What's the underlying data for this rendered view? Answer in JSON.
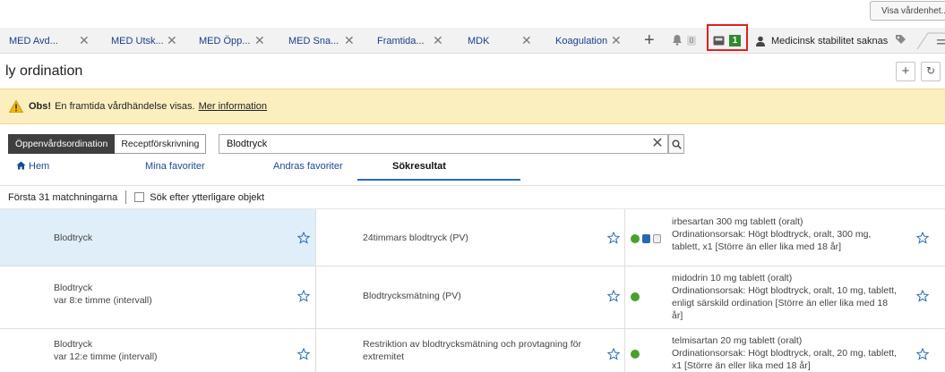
{
  "top_corner_label": "Visa vårdenhet...",
  "tabs": [
    {
      "label": "MED Avd..."
    },
    {
      "label": "MED Utsk..."
    },
    {
      "label": "MED Öpp..."
    },
    {
      "label": "MED Sna..."
    },
    {
      "label": "Framtida..."
    },
    {
      "label": "MDK"
    },
    {
      "label": "Koagulation"
    }
  ],
  "toolbar": {
    "notification_count": "0",
    "inbox_count": "1",
    "patient_status": "Medicinsk stabilitet saknas"
  },
  "page": {
    "title": "ly ordination",
    "add_label": "+",
    "refresh_label": "↻"
  },
  "notice": {
    "bold": "Obs!",
    "text": "En framtida vårdhändelse visas.",
    "link": "Mer information",
    "color": "#fbefc0"
  },
  "ordination_types": [
    {
      "label": "Öppenvårdsordination"
    },
    {
      "label": "Receptförskrivning"
    }
  ],
  "search": {
    "value": "Blodtryck",
    "clear_label": "✕"
  },
  "nav_tabs": [
    {
      "label": "Hem"
    },
    {
      "label": "Mina favoriter"
    },
    {
      "label": "Andras favoriter"
    },
    {
      "label": "Sökresultat"
    }
  ],
  "results_bar": {
    "count_label": "Första 31 matchningarna",
    "more_label": "Sök efter ytterligare objekt"
  },
  "rows": [
    {
      "col1": {
        "line1": "Blodtryck",
        "line2": ""
      },
      "col2": {
        "line1": "24timmars blodtryck (PV)",
        "line2": ""
      },
      "col3": {
        "line1": "irbesartan 300 mg tablett (oralt)",
        "line2": "Ordinationsorsak: Högt blodtryck, oralt, 300 mg,",
        "line3": "tablett, x1 [Större än eller lika med 18 år]",
        "line4": ""
      }
    },
    {
      "col1": {
        "line1": "Blodtryck",
        "line2": "var 8:e timme (intervall)"
      },
      "col2": {
        "line1": "Blodtrycksmätning (PV)",
        "line2": ""
      },
      "col3": {
        "line1": "midodrin 10 mg tablett (oralt)",
        "line2": "Ordinationsorsak: Högt blodtryck, oralt, 10 mg, tablett,",
        "line3": "enligt särskild ordination [Större än eller lika med 18",
        "line4": "år]"
      }
    },
    {
      "col1": {
        "line1": "Blodtryck",
        "line2": "var 12:e timme (intervall)"
      },
      "col2": {
        "line1": "Restriktion av blodtrycksmätning och provtagning för",
        "line2": "extremitet"
      },
      "col3": {
        "line1": "telmisartan 20 mg tablett (oralt)",
        "line2": "Ordinationsorsak: Högt blodtryck, oralt, 20 mg, tablett,",
        "line3": "x1 [Större än eller lika med 18 år]",
        "line4": ""
      }
    }
  ],
  "colors": {
    "selected_row": "#dfeef8",
    "link_blue": "#1b3e8a",
    "status_green": "#4aa02c"
  }
}
